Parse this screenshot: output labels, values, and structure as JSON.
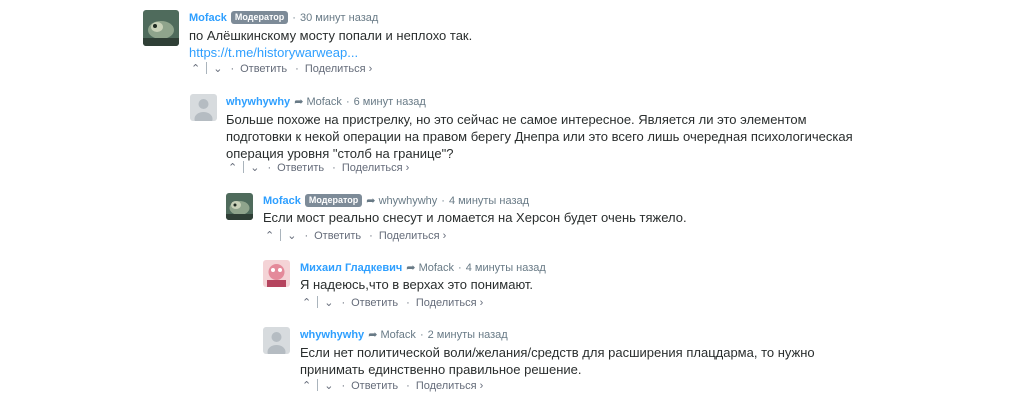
{
  "comments": [
    {
      "author": "Mofack",
      "badge": "Модератор",
      "reply_to": "",
      "time": "30 минут назад",
      "lines": [
        "по Алёшкинскому мосту попали и неплохо так."
      ],
      "link": "https://t.me/historywarweap...",
      "reply": "Ответить",
      "share": "Поделиться ›"
    },
    {
      "author": "whywhywhy",
      "badge": "",
      "reply_to": "Mofack",
      "time": "6 минут назад",
      "lines": [
        "Больше похоже на пристрелку, но это сейчас не самое интересное. Является ли это элементом",
        "подготовки к некой операции на правом берегу Днепра или это всего лишь очередная психологическая",
        "операция уровня \"столб на границе\"?"
      ],
      "reply": "Ответить",
      "share": "Поделиться ›"
    },
    {
      "author": "Mofack",
      "badge": "Модератор",
      "reply_to": "whywhywhy",
      "time": "4 минуты назад",
      "lines": [
        "Если мост реально снесут и ломается на Херсон будет очень тяжело."
      ],
      "reply": "Ответить",
      "share": "Поделиться ›"
    },
    {
      "author": "Михаил Гладкевич",
      "badge": "",
      "reply_to": "Mofack",
      "time": "4 минуты назад",
      "lines": [
        "Я надеюсь,что в верхах это понимают."
      ],
      "reply": "Ответить",
      "share": "Поделиться ›"
    },
    {
      "author": "whywhywhy",
      "badge": "",
      "reply_to": "Mofack",
      "time": "2 минуты назад",
      "lines": [
        "Если нет политической воли/желания/средств для расширения плацдарма, то нужно",
        "принимать единственно правильное решение."
      ],
      "reply": "Ответить",
      "share": "Поделиться ›"
    }
  ],
  "icons": {
    "upvote": "chevron-up-icon",
    "downvote": "chevron-down-icon",
    "reply_arrow": "reply-arrow-icon"
  },
  "glyphs": {
    "up": "⌃",
    "down": "⌄",
    "arrow": "➦",
    "dot": "·"
  }
}
